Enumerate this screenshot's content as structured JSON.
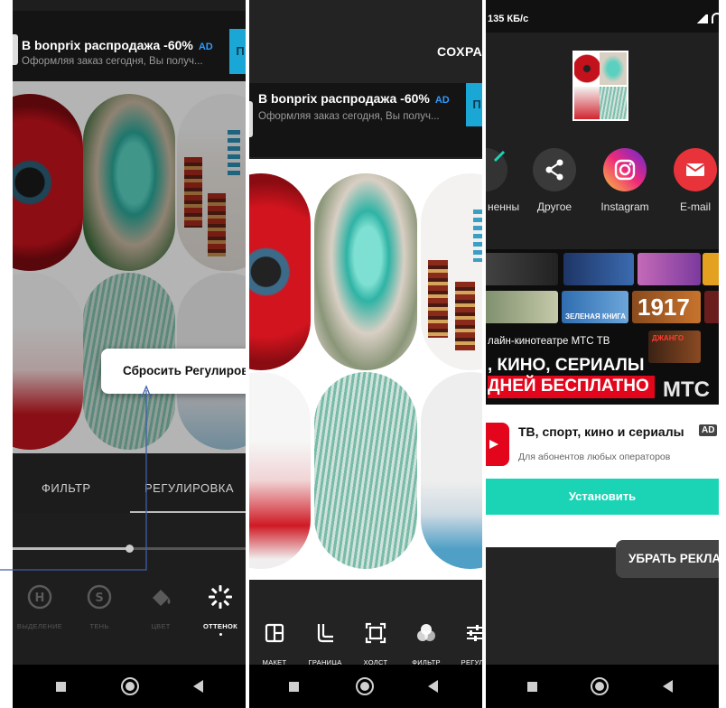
{
  "panel1": {
    "ad": {
      "title": "В bonprix распродажа -60%",
      "tag": "AD",
      "subtitle": "Оформляя заказ сегодня, Вы получ...",
      "button": "П"
    },
    "popup": {
      "text": "Сбросить Регулиров"
    },
    "tabs": {
      "filter": "ФИЛЬТР",
      "adjust": "РЕГУЛИРОВКА"
    },
    "slider": {
      "value_fraction": 0.5
    },
    "tools": [
      {
        "label": "ВЫДЕЛЕНИЕ",
        "icon": "highlight-icon"
      },
      {
        "label": "ТЕНЬ",
        "icon": "shadow-icon"
      },
      {
        "label": "ЦВЕТ",
        "icon": "color-bucket-icon"
      },
      {
        "label": "ОТТЕНОК",
        "icon": "tint-icon"
      }
    ]
  },
  "panel2": {
    "save": "СОХРА",
    "ad": {
      "title": "В bonprix распродажа -60%",
      "tag": "AD",
      "subtitle": "Оформляя заказ сегодня, Вы получ...",
      "button": "П"
    },
    "tools": [
      {
        "label": "МАКЕТ",
        "icon": "layout-icon"
      },
      {
        "label": "ГРАНИЦА",
        "icon": "border-icon"
      },
      {
        "label": "ХОЛСТ",
        "icon": "canvas-icon"
      },
      {
        "label": "ФИЛЬТР",
        "icon": "filter-icon"
      },
      {
        "label": "РЕГУЛИ",
        "icon": "adjust-icon"
      }
    ]
  },
  "panel3": {
    "status": {
      "speed": "135 КБ/с"
    },
    "share": [
      {
        "label": "ненны",
        "icon": "check-icon"
      },
      {
        "label": "Другое",
        "icon": "share-icon"
      },
      {
        "label": "Instagram",
        "icon": "instagram-icon"
      },
      {
        "label": "E-mail",
        "icon": "mail-icon"
      }
    ],
    "banner": {
      "line1": "лайн-кинотеатре МТС ТВ",
      "line2": ", КИНО, СЕРИАЛЫ",
      "line3": "ДНЕЙ БЕСПЛАТНО",
      "logo": "МТС",
      "posters": [
        "1917",
        "ЗЕЛЕНАЯ КНИГА",
        "ДЖАНГО"
      ]
    },
    "ad": {
      "title": "ТВ, спорт, кино и сериалы",
      "tag": "AD",
      "subtitle": "Для абонентов любых операторов",
      "install": "Установить"
    },
    "remove_ads": "УБРАТЬ РЕКЛА"
  },
  "colors": {
    "accent_blue": "#2e9bff",
    "install_teal": "#1bd4b5",
    "mts_red": "#e3051b",
    "dark_bg": "#1e1e1e"
  }
}
